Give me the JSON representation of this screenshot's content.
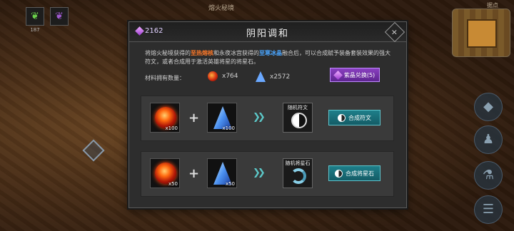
{
  "scene": {
    "top_title": "熔火秘境",
    "top_items": [
      {
        "icon": "green-feather-icon",
        "count": "187"
      },
      {
        "icon": "purple-feather-icon",
        "count": ""
      }
    ],
    "minimap_label": "据点"
  },
  "modal": {
    "currency_value": "2162",
    "title": "阴阳调和",
    "close_label": "×",
    "desc_part1": "将熔火秘境获得的",
    "desc_hl1": "至热熔核",
    "desc_part2": "和永夜冰宫获得的",
    "desc_hl2": "至寒冰晶",
    "desc_part3": "融合后，可以合成赋予装备套装效果的强大符文，或者合成用于激活英雄将星的将星石。",
    "owned_label": "材料拥有数量：",
    "owned_ember": "x764",
    "owned_crystal": "x2572",
    "exchange_label": "紫晶兑换(5)",
    "recipes": [
      {
        "input1_qty": "x100",
        "input2_qty": "x100",
        "plus": "+",
        "arrows": "❯❯",
        "result_label": "随机符文",
        "button": "合成符文"
      },
      {
        "input1_qty": "x50",
        "input2_qty": "x50",
        "plus": "+",
        "arrows": "❯❯",
        "result_label": "随机将星石",
        "button": "合成将星石"
      }
    ]
  },
  "colors": {
    "accent_teal": "#1e7f8a",
    "accent_purple": "#8a40c0",
    "highlight_red": "#ff7a2a",
    "highlight_blue": "#4aa6ff"
  }
}
